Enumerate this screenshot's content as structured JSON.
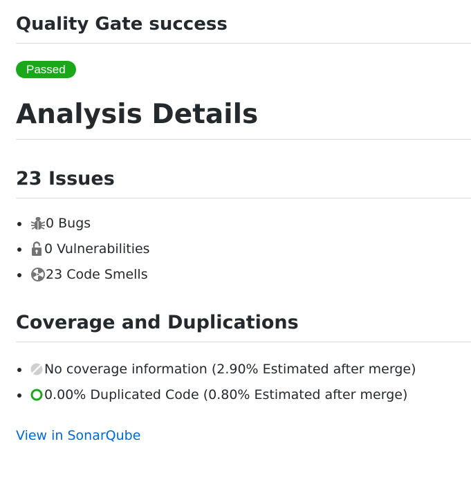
{
  "gate": {
    "title": "Quality Gate success",
    "badge": "Passed",
    "badge_color": "#1aa71a"
  },
  "analysis": {
    "title": "Analysis Details"
  },
  "issues": {
    "title": "23 Issues",
    "items": [
      {
        "icon": "bug-icon",
        "label": "0 Bugs"
      },
      {
        "icon": "unlocked-padlock-icon",
        "label": "0 Vulnerabilities"
      },
      {
        "icon": "code-smell-icon",
        "label": "23 Code Smells"
      }
    ]
  },
  "coverage": {
    "title": "Coverage and Duplications",
    "items": [
      {
        "icon": "no-coverage-icon",
        "label": "No coverage information (2.90% Estimated after merge)"
      },
      {
        "icon": "duplication-ring-icon",
        "label": "0.00% Duplicated Code (0.80% Estimated after merge)"
      }
    ]
  },
  "link": {
    "label": "View in SonarQube",
    "color": "#0366d6"
  }
}
